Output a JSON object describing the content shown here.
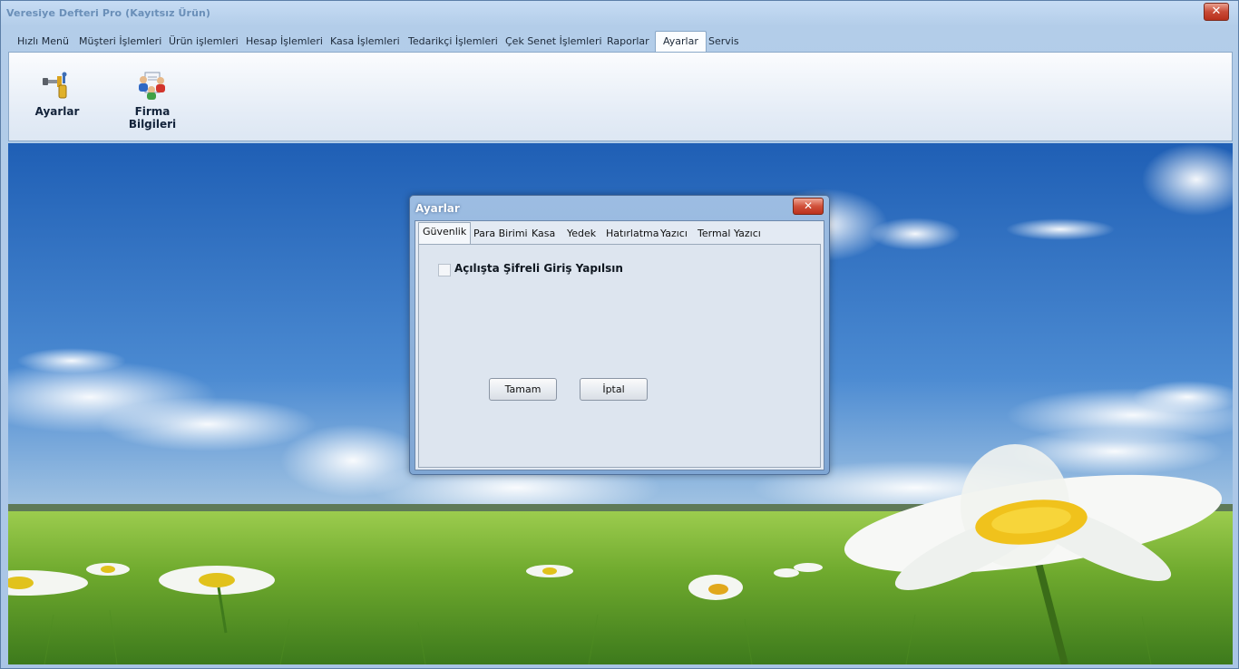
{
  "window": {
    "title": "Veresiye Defteri Pro (Kayıtsız Ürün)",
    "close_glyph": "✕"
  },
  "menu_tabs": [
    {
      "label": "Hızlı Menü"
    },
    {
      "label": "Müşteri İşlemleri"
    },
    {
      "label": "Ürün işlemleri"
    },
    {
      "label": "Hesap İşlemleri"
    },
    {
      "label": "Kasa İşlemleri"
    },
    {
      "label": "Tedarikçi İşlemleri"
    },
    {
      "label": "Çek Senet İşlemleri"
    },
    {
      "label": "Raporlar"
    },
    {
      "label": "Ayarlar"
    },
    {
      "label": "Servis"
    }
  ],
  "ribbon": {
    "buttons": [
      {
        "label": "Ayarlar",
        "icon": "tools-icon"
      },
      {
        "label": "Firma Bilgileri",
        "icon": "company-people-icon"
      }
    ]
  },
  "dialog": {
    "title": "Ayarlar",
    "close_glyph": "✕",
    "tabs": [
      {
        "label": "Güvenlik"
      },
      {
        "label": "Para Birimi"
      },
      {
        "label": "Kasa"
      },
      {
        "label": "Yedek"
      },
      {
        "label": "Hatırlatma"
      },
      {
        "label": "Yazıcı"
      },
      {
        "label": "Termal Yazıcı"
      }
    ],
    "checkbox_label": "Açılışta Şifreli Giriş Yapılsın",
    "checkbox_checked": false,
    "ok_label": "Tamam",
    "cancel_label": "İptal"
  }
}
